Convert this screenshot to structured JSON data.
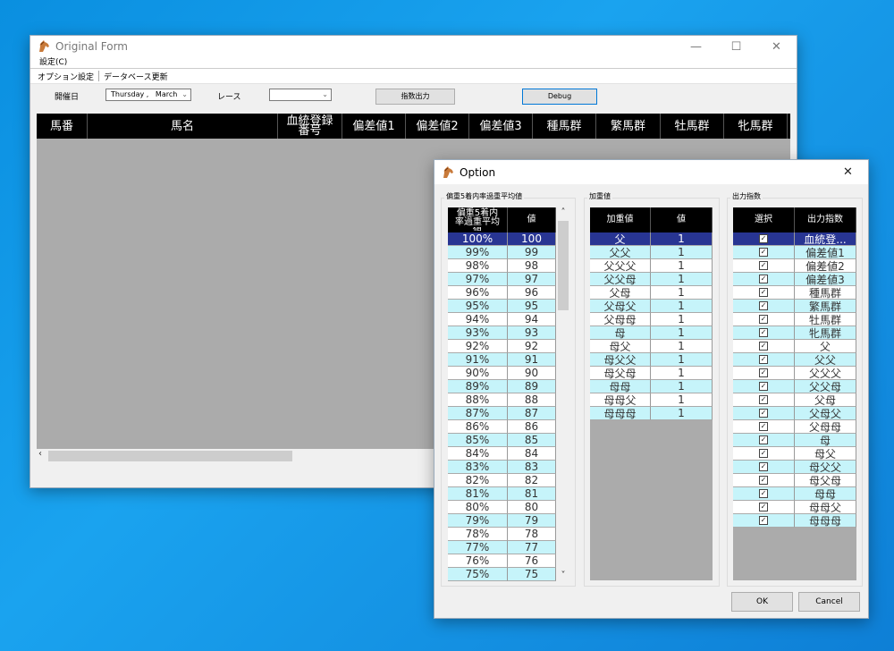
{
  "main_window": {
    "title": "Original Form",
    "menu": {
      "settings": "設定(C)"
    },
    "toolbar": {
      "option_settings": "オプション設定",
      "db_update": "データベース更新"
    },
    "controls": {
      "date_label": "開催日",
      "date_value": "Thursday ,   March",
      "race_label": "レース",
      "race_value": "",
      "output_button": "指数出力",
      "debug_button": "Debug"
    },
    "grid_columns": [
      "馬番",
      "馬名",
      "血統登録番号",
      "偏差値1",
      "偏差値2",
      "偏差値3",
      "種馬群",
      "繁馬群",
      "牡馬群",
      "牝馬群"
    ],
    "grid_column_blood_line1": "血統登録",
    "grid_column_blood_line2": "番号"
  },
  "option_dialog": {
    "title": "Option",
    "group1": {
      "title": "偏重5着内率過重平均値",
      "header_col1_line1": "偏重5着内",
      "header_col1_line2": "率過重平均",
      "header_col1_line3": "値",
      "header_col2": "値",
      "rows": [
        [
          "100%",
          "100"
        ],
        [
          "99%",
          "99"
        ],
        [
          "98%",
          "98"
        ],
        [
          "97%",
          "97"
        ],
        [
          "96%",
          "96"
        ],
        [
          "95%",
          "95"
        ],
        [
          "94%",
          "94"
        ],
        [
          "93%",
          "93"
        ],
        [
          "92%",
          "92"
        ],
        [
          "91%",
          "91"
        ],
        [
          "90%",
          "90"
        ],
        [
          "89%",
          "89"
        ],
        [
          "88%",
          "88"
        ],
        [
          "87%",
          "87"
        ],
        [
          "86%",
          "86"
        ],
        [
          "85%",
          "85"
        ],
        [
          "84%",
          "84"
        ],
        [
          "83%",
          "83"
        ],
        [
          "82%",
          "82"
        ],
        [
          "81%",
          "81"
        ],
        [
          "80%",
          "80"
        ],
        [
          "79%",
          "79"
        ],
        [
          "78%",
          "78"
        ],
        [
          "77%",
          "77"
        ],
        [
          "76%",
          "76"
        ],
        [
          "75%",
          "75"
        ]
      ]
    },
    "group2": {
      "title": "加重値",
      "header_col1": "加重値",
      "header_col2": "値",
      "rows": [
        [
          "父",
          "1"
        ],
        [
          "父父",
          "1"
        ],
        [
          "父父父",
          "1"
        ],
        [
          "父父母",
          "1"
        ],
        [
          "父母",
          "1"
        ],
        [
          "父母父",
          "1"
        ],
        [
          "父母母",
          "1"
        ],
        [
          "母",
          "1"
        ],
        [
          "母父",
          "1"
        ],
        [
          "母父父",
          "1"
        ],
        [
          "母父母",
          "1"
        ],
        [
          "母母",
          "1"
        ],
        [
          "母母父",
          "1"
        ],
        [
          "母母母",
          "1"
        ]
      ]
    },
    "group3": {
      "title": "出力指数",
      "header_col1": "選択",
      "header_col2": "出力指数",
      "checkbox_glyph": "✓",
      "rows": [
        [
          "血統登...",
          true
        ],
        [
          "偏差値1",
          true
        ],
        [
          "偏差値2",
          true
        ],
        [
          "偏差値3",
          true
        ],
        [
          "種馬群",
          true
        ],
        [
          "繁馬群",
          true
        ],
        [
          "牡馬群",
          true
        ],
        [
          "牝馬群",
          true
        ],
        [
          "父",
          true
        ],
        [
          "父父",
          true
        ],
        [
          "父父父",
          true
        ],
        [
          "父父母",
          true
        ],
        [
          "父母",
          true
        ],
        [
          "父母父",
          true
        ],
        [
          "父母母",
          true
        ],
        [
          "母",
          true
        ],
        [
          "母父",
          true
        ],
        [
          "母父父",
          true
        ],
        [
          "母父母",
          true
        ],
        [
          "母母",
          true
        ],
        [
          "母母父",
          true
        ],
        [
          "母母母",
          true
        ]
      ]
    },
    "ok_button": "OK",
    "cancel_button": "Cancel"
  },
  "icons": {
    "minimize": "—",
    "maximize": "☐",
    "close": "✕",
    "dropdown": "⌄",
    "scroll_left": "‹",
    "scroll_up": "˄",
    "scroll_down": "˅"
  }
}
